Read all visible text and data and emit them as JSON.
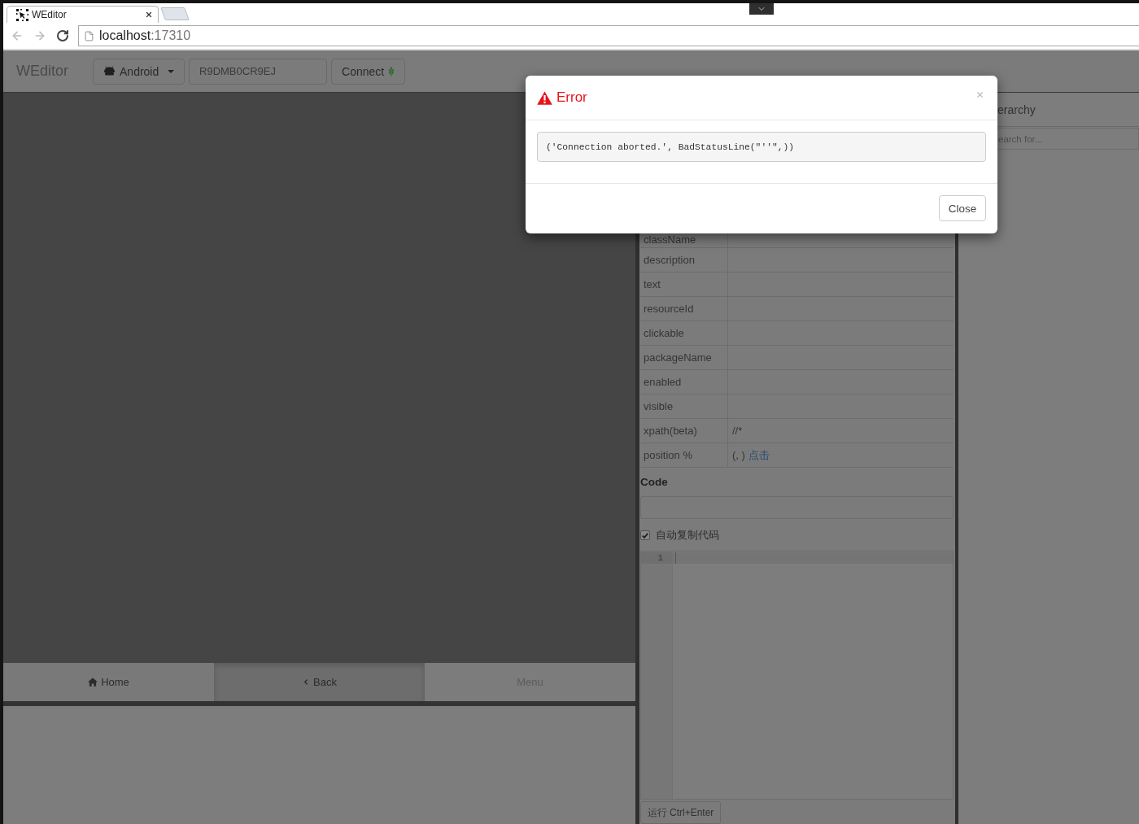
{
  "browser": {
    "tab": {
      "title": "WEditor"
    },
    "address": {
      "host": "localhost",
      "port": ":17310"
    }
  },
  "navbar": {
    "brand": "WEditor",
    "platform": {
      "label": "Android"
    },
    "serial": {
      "value": "R9DMB0CR9EJ"
    },
    "connect": {
      "label": "Connect"
    }
  },
  "device_nav": [
    {
      "kind": "home",
      "label": "Home",
      "pressed": false,
      "disabled": false
    },
    {
      "kind": "back",
      "label": "Back",
      "pressed": true,
      "disabled": false
    },
    {
      "kind": "menu",
      "label": "Menu",
      "pressed": false,
      "disabled": true
    }
  ],
  "properties": [
    {
      "name": "className"
    },
    {
      "name": "description"
    },
    {
      "name": "text"
    },
    {
      "name": "resourceId"
    },
    {
      "name": "clickable"
    },
    {
      "name": "packageName"
    },
    {
      "name": "enabled"
    },
    {
      "name": "visible"
    },
    {
      "name": "xpath(beta)",
      "value": "//*"
    },
    {
      "name": "position %",
      "value": "(, )",
      "link": "点击"
    }
  ],
  "code": {
    "heading": "Code",
    "auto_copy": {
      "label": "自动复制代码",
      "checked": true
    },
    "editor": {
      "line_numbers": [
        "1"
      ]
    },
    "run_button": {
      "label": "运行 Ctrl+Enter"
    }
  },
  "hierarchy": {
    "title": "erarchy",
    "search": {
      "placeholder": "earch for..."
    }
  },
  "dialog": {
    "title": "Error",
    "message": "('Connection aborted.', BadStatusLine(\"''\",))",
    "buttons": [
      "Close"
    ]
  }
}
